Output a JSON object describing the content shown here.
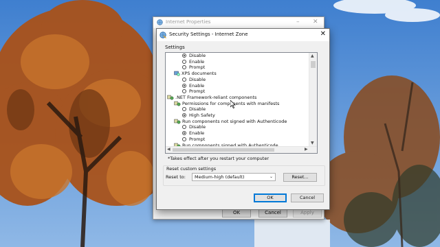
{
  "colors": {
    "accent": "#0078d7",
    "dialog_bg": "#f0f0f0",
    "sky": "#5b8fc9",
    "foliage": "#b0561c"
  },
  "internet_properties": {
    "title": "Internet Properties",
    "minimize_glyph": "–",
    "close_glyph": "✕",
    "ok_label": "OK",
    "cancel_label": "Cancel",
    "apply_label": "Apply"
  },
  "security_settings": {
    "title": "Security Settings - Internet Zone",
    "close_glyph": "✕",
    "settings_label": "Settings",
    "tree": [
      {
        "kind": "radio",
        "label": "Disable",
        "checked": true,
        "indent": 1
      },
      {
        "kind": "radio",
        "label": "Enable",
        "checked": false,
        "indent": 1
      },
      {
        "kind": "radio",
        "label": "Prompt",
        "checked": false,
        "indent": 1
      },
      {
        "kind": "setting",
        "label": "XPS documents",
        "icon": "settings-gear-icon",
        "indent": 1
      },
      {
        "kind": "radio",
        "label": "Disable",
        "checked": false,
        "indent": 1
      },
      {
        "kind": "radio",
        "label": "Enable",
        "checked": true,
        "indent": 1
      },
      {
        "kind": "radio",
        "label": "Prompt",
        "checked": false,
        "indent": 1
      },
      {
        "kind": "group",
        "label": ".NET Framework-reliant components",
        "icon": "component-group-icon",
        "indent": 0
      },
      {
        "kind": "setting",
        "label": "Permissions for components with manifests",
        "icon": "component-icon",
        "indent": 1
      },
      {
        "kind": "radio",
        "label": "Disable",
        "checked": false,
        "indent": 1
      },
      {
        "kind": "radio",
        "label": "High Safety",
        "checked": true,
        "indent": 1
      },
      {
        "kind": "setting",
        "label": "Run components not signed with Authenticode",
        "icon": "component-icon",
        "indent": 1
      },
      {
        "kind": "radio",
        "label": "Disable",
        "checked": false,
        "indent": 1
      },
      {
        "kind": "radio",
        "label": "Enable",
        "checked": true,
        "indent": 1
      },
      {
        "kind": "radio",
        "label": "Prompt",
        "checked": false,
        "indent": 1
      },
      {
        "kind": "setting",
        "label": "Run components signed with Authenticode",
        "icon": "component-icon",
        "indent": 1
      }
    ],
    "restart_note": "*Takes effect after you restart your computer",
    "reset_group_label": "Reset custom settings",
    "reset_to_label": "Reset to:",
    "reset_to_value": "Medium-high (default)",
    "reset_button_label": "Reset...",
    "ok_label": "OK",
    "cancel_label": "Cancel"
  }
}
